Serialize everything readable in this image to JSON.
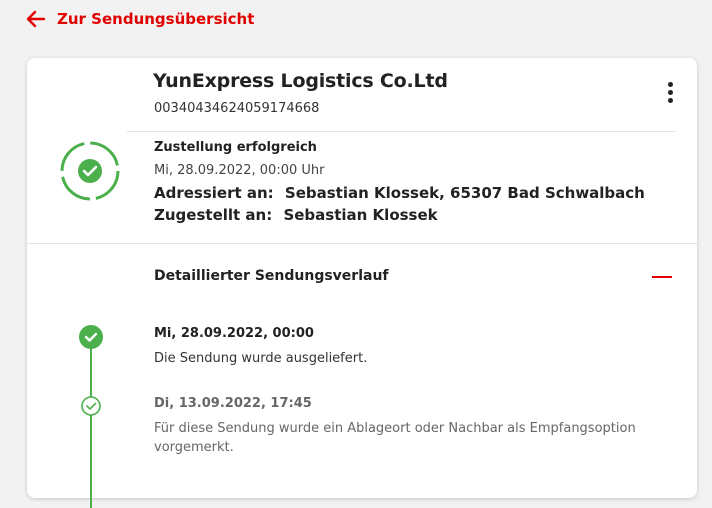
{
  "nav": {
    "back_label": "Zur Sendungsübersicht"
  },
  "shipment": {
    "carrier": "YunExpress Logistics Co.Ltd",
    "tracking_number": "00340434624059174668",
    "status_title": "Zustellung erfolgreich",
    "status_datetime": "Mi, 28.09.2022, 00:00 Uhr",
    "addressed_label": "Adressiert an:",
    "addressed_value": "Sebastian Klossek, 65307 Bad Schwalbach",
    "delivered_label": "Zugestellt an:",
    "delivered_value": "Sebastian Klossek"
  },
  "history": {
    "title": "Detaillierter Sendungsverlauf",
    "events": [
      {
        "datetime": "Mi, 28.09.2022, 00:00",
        "description": "Die Sendung wurde ausgeliefert."
      },
      {
        "datetime": "Di, 13.09.2022, 17:45",
        "description": "Für diese Sendung wurde ein Ablageort oder Nachbar als Empfangsoption vorgemerkt."
      }
    ]
  },
  "colors": {
    "accent": "#e00000",
    "success": "#4bb04b"
  },
  "icons": {
    "back": "arrow-left-icon",
    "menu": "more-vertical-icon",
    "status": "check-circle-icon",
    "collapse": "minus-icon"
  }
}
